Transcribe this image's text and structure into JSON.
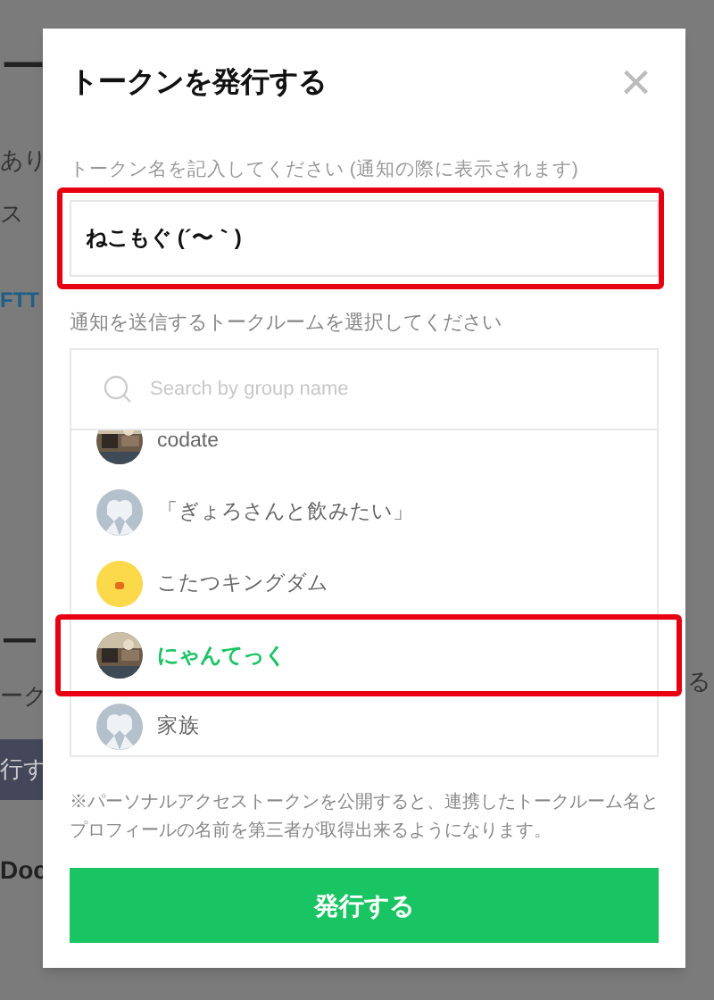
{
  "background": {
    "texts": [
      "ー",
      "あり",
      "ス",
      "FTT",
      "ー",
      "ーク",
      "行す",
      "Doc"
    ],
    "right_text": "る"
  },
  "dialog": {
    "title": "トークンを発行する",
    "close": "×",
    "token_field": {
      "label": "トークン名を記入してください (通知の際に表示されます)",
      "value": "ねこもぐ (´〜｀)",
      "annotated": true
    },
    "room_label": "通知を送信するトークルームを選択してください",
    "search": {
      "placeholder": "Search by group name"
    },
    "rooms": [
      {
        "name": "codate",
        "selected": false,
        "annotated": false
      },
      {
        "name": "「ぎょろさんと飲みたい」",
        "kind": "default",
        "selected": false,
        "annotated": false
      },
      {
        "name": "こたつキングダム",
        "kind": "yellow",
        "selected": false,
        "annotated": false
      },
      {
        "name": "にゃんてっく",
        "selected": true,
        "annotated": true
      },
      {
        "name": "家族",
        "kind": "default",
        "selected": false,
        "annotated": false
      }
    ],
    "note": "※パーソナルアクセストークンを公開すると、連携したトークルーム名とプロフィールの名前を第三者が取得出来るようになります。",
    "submit": "発行する"
  }
}
